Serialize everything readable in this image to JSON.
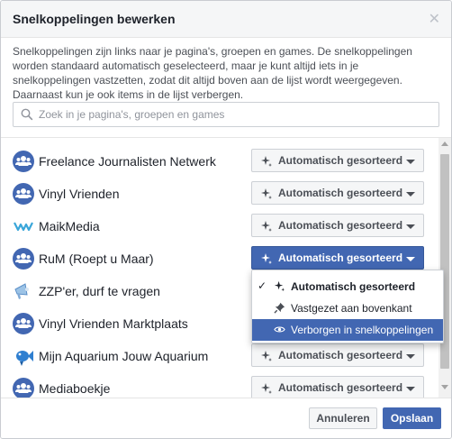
{
  "dialog": {
    "title": "Snelkoppelingen bewerken",
    "close_icon": "close-icon",
    "description": "Snelkoppelingen zijn links naar je pagina's, groepen en games. De snelkoppelingen worden standaard automatisch geselecteerd, maar je kunt altijd iets in je snelkoppelingen vastzetten, zodat dit altijd boven aan de lijst wordt weergegeven. Daarnaast kun je ook items in de lijst verbergen."
  },
  "search": {
    "placeholder": "Zoek in je pagina's, groepen en games",
    "value": ""
  },
  "items": [
    {
      "label": "Freelance Journalisten Netwerk",
      "icon": "group-icon",
      "sort": "Automatisch gesorteerd"
    },
    {
      "label": "Vinyl Vrienden",
      "icon": "group-icon",
      "sort": "Automatisch gesorteerd"
    },
    {
      "label": "MaikMedia",
      "icon": "page-logo-icon",
      "sort": "Automatisch gesorteerd"
    },
    {
      "label": "RuM (Roept u Maar)",
      "icon": "group-icon",
      "sort": "Automatisch gesorteerd"
    },
    {
      "label": "ZZP'er, durf te vragen",
      "icon": "megaphone-icon",
      "sort": "Automatisch gesorteerd"
    },
    {
      "label": "Vinyl Vrienden Marktplaats",
      "icon": "group-icon",
      "sort": "Automatisch gesorteerd"
    },
    {
      "label": "Mijn Aquarium Jouw Aquarium",
      "icon": "fish-icon",
      "sort": "Automatisch gesorteerd"
    },
    {
      "label": "Mediaboekje",
      "icon": "group-icon",
      "sort": "Automatisch gesorteerd"
    }
  ],
  "dropdown": {
    "options": [
      {
        "label": "Automatisch gesorteerd",
        "checked": true
      },
      {
        "label": "Vastgezet aan bovenkant",
        "checked": false
      },
      {
        "label": "Verborgen in snelkoppelingen",
        "checked": false
      }
    ]
  },
  "footer": {
    "cancel_label": "Annuleren",
    "save_label": "Opslaan"
  },
  "colors": {
    "accent": "#4267b2",
    "group_icon": "#4267b2",
    "text": "#1d2129"
  }
}
